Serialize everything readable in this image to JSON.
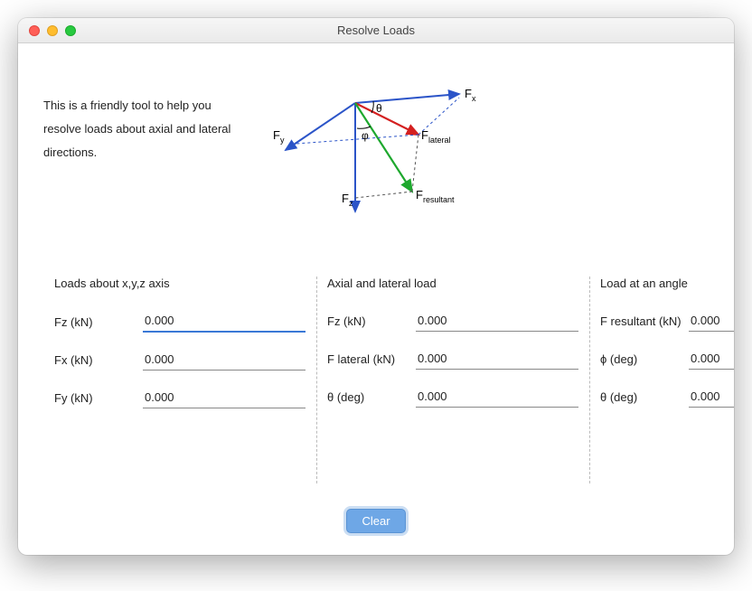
{
  "window": {
    "title": "Resolve Loads"
  },
  "intro": "This is a friendly tool to help you resolve loads about axial and lateral directions.",
  "diagram": {
    "fx": "F",
    "fx_sub": "x",
    "fy": "F",
    "fy_sub": "y",
    "fz": "F",
    "fz_sub": "z",
    "flat": "F",
    "flat_sub": "lateral",
    "fres": "F",
    "fres_sub": "resultant",
    "theta": "θ",
    "phi": "φ"
  },
  "groups": {
    "xyz": {
      "title": "Loads about x,y,z axis",
      "fields": [
        {
          "label": "Fz (kN)",
          "value": "0.000",
          "active": true
        },
        {
          "label": "Fx (kN)",
          "value": "0.000"
        },
        {
          "label": "Fy (kN)",
          "value": "0.000"
        }
      ]
    },
    "axial": {
      "title": "Axial and lateral load",
      "fields": [
        {
          "label": "Fz (kN)",
          "value": "0.000"
        },
        {
          "label": "F lateral (kN)",
          "value": "0.000"
        },
        {
          "label": "θ (deg)",
          "value": "0.000"
        }
      ]
    },
    "angle": {
      "title": "Load at an angle",
      "fields": [
        {
          "label": "F resultant (kN)",
          "value": "0.000"
        },
        {
          "label": "ϕ (deg)",
          "value": "0.000"
        },
        {
          "label": "θ (deg)",
          "value": "0.000"
        }
      ]
    }
  },
  "buttons": {
    "clear": "Clear"
  }
}
